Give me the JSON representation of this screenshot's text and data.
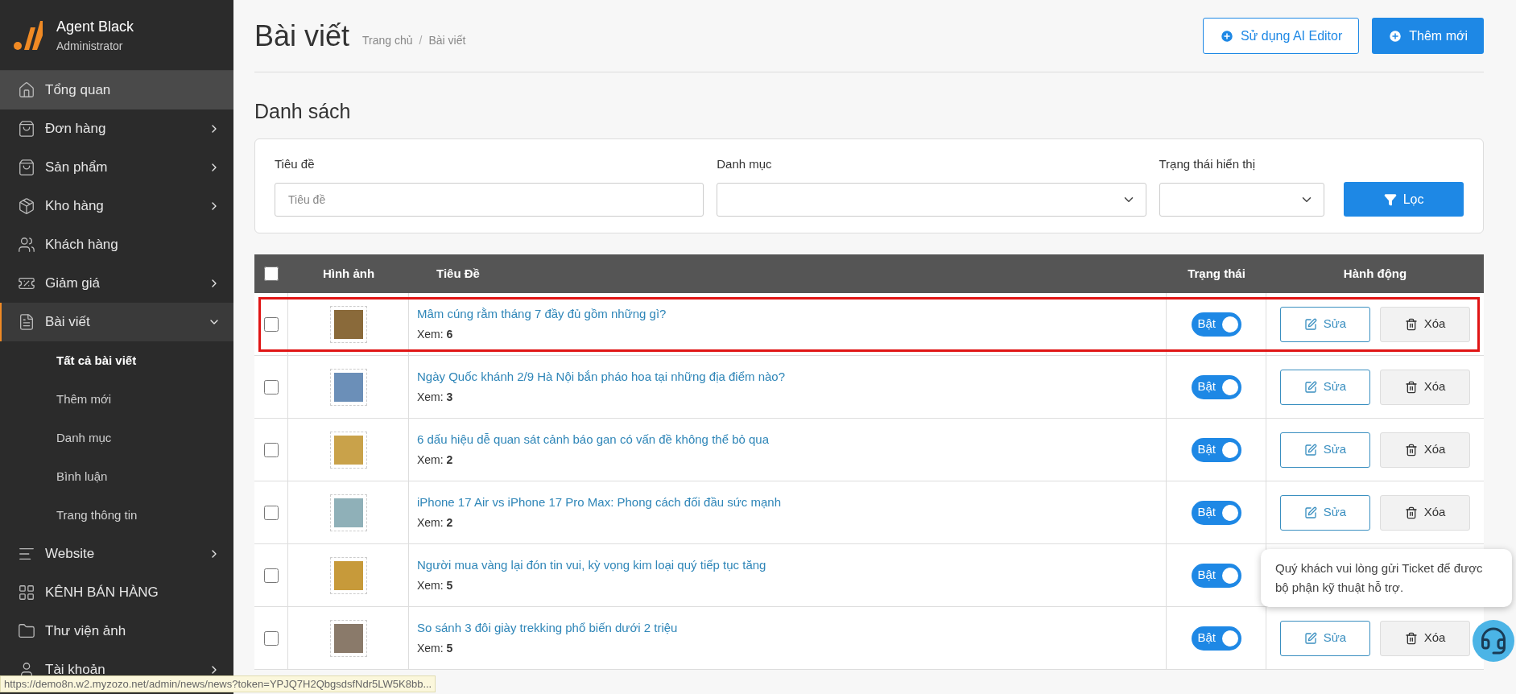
{
  "brand": {
    "name": "Agent Black",
    "role": "Administrator"
  },
  "sidebar": {
    "items": [
      {
        "label": "Tổng quan",
        "kind": "link",
        "hovered": true,
        "selected": false
      },
      {
        "label": "Đơn hàng",
        "kind": "group",
        "expanded": false,
        "hovered": false,
        "selected": false
      },
      {
        "label": "Sản phẩm",
        "kind": "group",
        "expanded": false,
        "hovered": false,
        "selected": false
      },
      {
        "label": "Kho hàng",
        "kind": "group",
        "expanded": false,
        "hovered": false,
        "selected": false
      },
      {
        "label": "Khách hàng",
        "kind": "link",
        "hovered": false,
        "selected": false
      },
      {
        "label": "Giảm giá",
        "kind": "group",
        "expanded": false,
        "hovered": false,
        "selected": false
      },
      {
        "label": "Bài viết",
        "kind": "group",
        "expanded": true,
        "hovered": false,
        "selected": true,
        "children": [
          {
            "label": "Tất cả bài viết",
            "selected": true
          },
          {
            "label": "Thêm mới",
            "selected": false
          },
          {
            "label": "Danh mục",
            "selected": false
          },
          {
            "label": "Bình luận",
            "selected": false
          },
          {
            "label": "Trang thông tin",
            "selected": false
          }
        ]
      },
      {
        "label": "Website",
        "kind": "group",
        "expanded": false,
        "hovered": false,
        "selected": false
      },
      {
        "label": "KÊNH BÁN HÀNG",
        "kind": "link",
        "hovered": false,
        "selected": false
      },
      {
        "label": "Thư viện ảnh",
        "kind": "link",
        "hovered": false,
        "selected": false
      },
      {
        "label": "Tài khoản",
        "kind": "group",
        "expanded": false,
        "hovered": false,
        "selected": false
      }
    ]
  },
  "page": {
    "title": "Bài viết",
    "breadcrumb": [
      "Trang chủ",
      "Bài viết"
    ],
    "breadcrumb_separator": "/",
    "buttons": [
      {
        "label": "Sử dụng AI Editor",
        "kind": "outline"
      },
      {
        "label": "Thêm mới",
        "kind": "primary"
      }
    ]
  },
  "section_title": "Danh sách",
  "filters": {
    "fields": [
      {
        "label": "Tiêu đề",
        "kind": "text",
        "placeholder": "Tiêu đề"
      },
      {
        "label": "Danh mục",
        "kind": "select"
      },
      {
        "label": "Trạng thái hiển thị",
        "kind": "select"
      }
    ],
    "button": "Lọc"
  },
  "table": {
    "select_all": {
      "checked": false
    },
    "columns": [
      "Hình ảnh",
      "Tiêu Đề",
      "Trạng thái",
      "Hành động"
    ],
    "rows": [
      {
        "title": "Mâm cúng rằm tháng 7 đầy đủ gồm những gì?",
        "views_label": "Xem:",
        "views": "6",
        "status": "Bật",
        "on": true,
        "checked": false,
        "highlighted": true,
        "edit": "Sửa",
        "delete": "Xóa"
      },
      {
        "title": "Ngày Quốc khánh 2/9 Hà Nội bắn pháo hoa tại những địa điểm nào?",
        "views_label": "Xem:",
        "views": "3",
        "status": "Bật",
        "on": true,
        "checked": false,
        "highlighted": false,
        "edit": "Sửa",
        "delete": "Xóa"
      },
      {
        "title": "6 dấu hiệu dễ quan sát cảnh báo gan có vấn đề không thể bỏ qua",
        "views_label": "Xem:",
        "views": "2",
        "status": "Bật",
        "on": true,
        "checked": false,
        "highlighted": false,
        "edit": "Sửa",
        "delete": "Xóa"
      },
      {
        "title": "iPhone 17 Air vs iPhone 17 Pro Max: Phong cách đối đầu sức mạnh",
        "views_label": "Xem:",
        "views": "2",
        "status": "Bật",
        "on": true,
        "checked": false,
        "highlighted": false,
        "edit": "Sửa",
        "delete": "Xóa"
      },
      {
        "title": "Người mua vàng lại đón tin vui, kỳ vọng kim loại quý tiếp tục tăng",
        "views_label": "Xem:",
        "views": "5",
        "status": "Bật",
        "on": true,
        "checked": false,
        "highlighted": false
      },
      {
        "title": "So sánh 3 đôi giày trekking phổ biến dưới 2 triệu",
        "views_label": "Xem:",
        "views": "5",
        "status": "Bật",
        "on": true,
        "checked": false,
        "highlighted": false,
        "edit": "Sửa",
        "delete": "Xóa"
      }
    ]
  },
  "support_popup": {
    "message": "Quý khách vui lòng gửi Ticket để được bộ phận kỹ thuật hỗ trợ."
  },
  "status_bar": {
    "url": "https://demo8n.w2.myzozo.net/admin/news/news?token=YPJQ7H2QbgsdsfNdr5LW5K8bb..."
  }
}
